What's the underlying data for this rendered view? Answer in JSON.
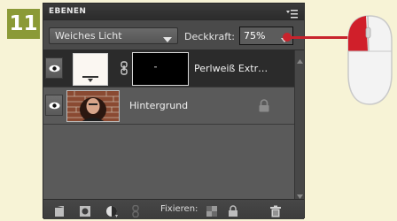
{
  "step": {
    "number": "11",
    "color": "#8b9a37"
  },
  "panel": {
    "title": "EBENEN",
    "menu_icon": "panel-menu-icon"
  },
  "toolbar": {
    "blend_mode": "Weiches Licht",
    "opacity_label": "Deckkraft:",
    "opacity_value": "75%"
  },
  "layers": [
    {
      "name": "Perlweiß Extr…",
      "visible": true,
      "selected": true,
      "has_mask": true
    },
    {
      "name": "Hintergrund",
      "visible": true,
      "selected": false,
      "locked": true
    }
  ],
  "footer": {
    "fix_label": "Fixieren:",
    "icons": [
      "new-layer-icon",
      "mask-icon",
      "adjustment-icon",
      "link-icon",
      "lock-transparent-icon",
      "lock-all-icon",
      "trash-icon"
    ]
  },
  "accent": {
    "pointer": "#c8232c",
    "selected_row": "#2b2b2b"
  }
}
